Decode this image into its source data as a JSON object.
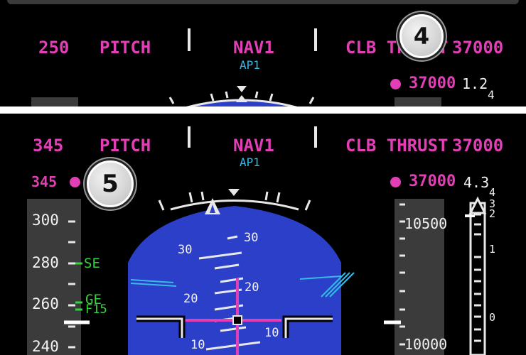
{
  "top_panel": {
    "fma": {
      "speed": "250",
      "pitch": "PITCH",
      "lateral_mode": "NAV1",
      "autopilot": "AP1",
      "thrust_mode": "CLB THRUST",
      "altitude": "37000"
    },
    "callout": "4",
    "altitude_preselect": "37000",
    "vs_readout": "1.2",
    "vs_scale_label": "4"
  },
  "bottom_panel": {
    "fma": {
      "speed": "345",
      "pitch": "PITCH",
      "lateral_mode": "NAV1",
      "autopilot": "AP1",
      "thrust_mode": "CLB THRUST",
      "altitude": "37000"
    },
    "speed_preselect": "345",
    "callout": "5",
    "altitude_preselect": "37000",
    "vs_readout": "4.3",
    "speed_tape": [
      "300",
      "280",
      "260",
      "240"
    ],
    "speed_markers": {
      "se": "SE",
      "ge": "GE",
      "f15": "F15"
    },
    "altitude_tape": [
      "10500",
      "10000"
    ],
    "pitch_scale": {
      "upper": "30",
      "middle": "20",
      "lower": "10"
    },
    "vs_scale": [
      "4",
      "3",
      "2",
      "1",
      "0"
    ]
  },
  "colors": {
    "magenta": "#e23fb6",
    "cyan": "#39b9e6",
    "sky": "#2c3fc8",
    "green": "#35d23e"
  }
}
